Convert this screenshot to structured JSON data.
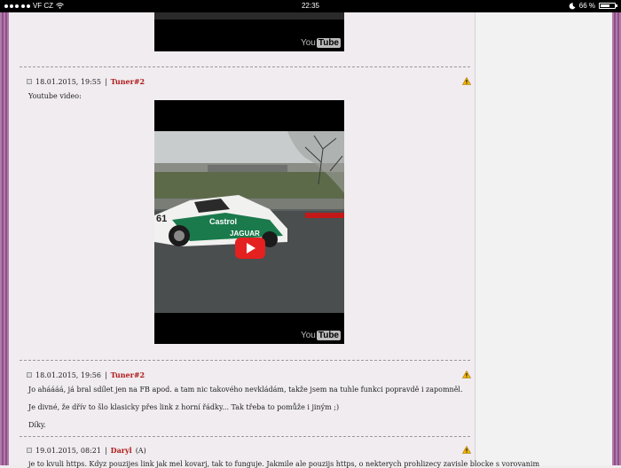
{
  "status_bar": {
    "carrier": "VF CZ",
    "time": "22:35",
    "battery": "66 %",
    "icons": [
      "signal-dots",
      "wifi-icon",
      "moon-icon",
      "battery-icon"
    ]
  },
  "video_logo": {
    "you": "You",
    "tube": "Tube"
  },
  "posts": [
    {
      "date": "18.01.2015, 19:55",
      "separator": "|",
      "user": "Tuner#2",
      "role": "",
      "text": "Youtube video:"
    },
    {
      "date": "18.01.2015, 19:56",
      "separator": "|",
      "user": "Tuner#2",
      "role": "",
      "paragraphs": [
        "Jo aháááá, já bral sdílet jen na FB apod. a tam nic takového nevkládám, takže jsem na tuhle funkci popravdě i zapomněl.",
        "Je divné, že dřív to šlo klasicky přes link z horní řádky... Tak třeba to pomůže i jiným ;)",
        "Díky."
      ]
    },
    {
      "date": "19.01.2015, 08:21",
      "separator": "|",
      "user": "Daryl",
      "role": "(A)",
      "text": "je to kvuli https. Kdyz pouzijes link jak mel kovarj, tak to funguje. Jakmile ale pouzijs https, o nekterych prohlizecy zavisle blocke s vorovanim"
    }
  ],
  "colors": {
    "username": "#b01b1b",
    "stripe": "#8e4f88",
    "play_button": "#e52020"
  }
}
